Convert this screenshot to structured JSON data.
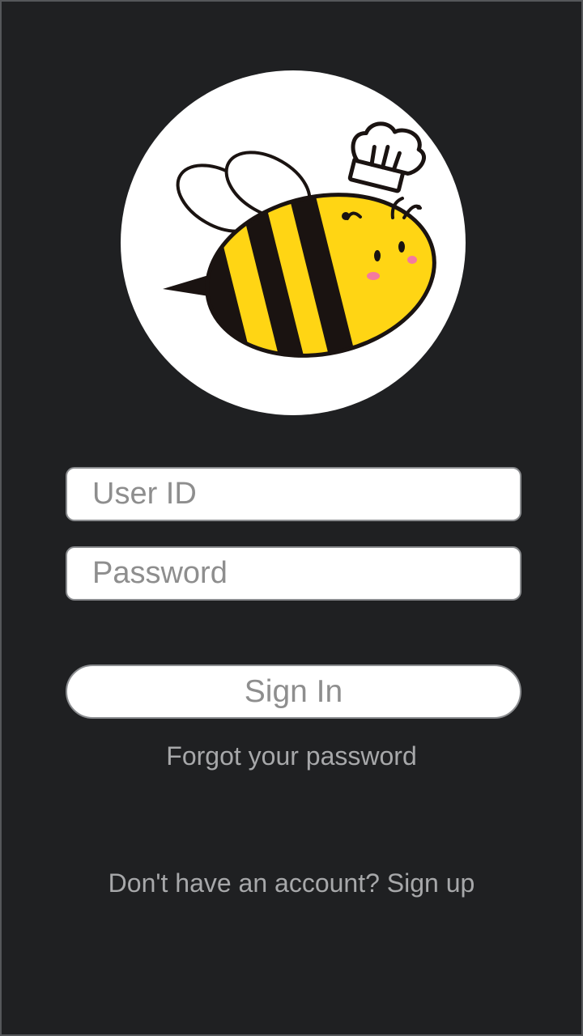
{
  "logo": {
    "icon": "bee-chef-icon",
    "colors": {
      "circle": "#ffffff",
      "body_yellow": "#ffd514",
      "stripes": "#1a1311",
      "cheeks": "#f47aa0"
    }
  },
  "form": {
    "user_id_placeholder": "User ID",
    "password_placeholder": "Password",
    "sign_in_label": "Sign In"
  },
  "links": {
    "forgot_password": "Forgot your password",
    "sign_up": "Don't have an account? Sign up"
  },
  "theme": {
    "background": "#1f2022",
    "muted_text": "#a7a8aa",
    "placeholder_text": "#8e8e8e"
  }
}
